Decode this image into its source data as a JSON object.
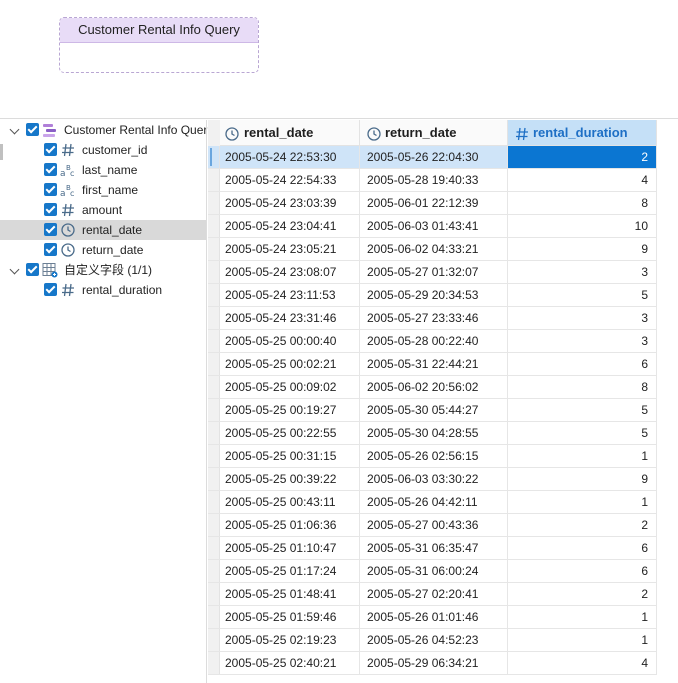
{
  "query_box": {
    "title": "Customer Rental Info Query"
  },
  "tree": {
    "root": {
      "label": "Customer Rental Info Quer",
      "icon": "query-icon",
      "checked": true,
      "expanded": true
    },
    "fields": [
      {
        "label": "customer_id",
        "icon": "hash-icon",
        "checked": true
      },
      {
        "label": "last_name",
        "icon": "abc-icon",
        "checked": true
      },
      {
        "label": "first_name",
        "icon": "abc-icon",
        "checked": true
      },
      {
        "label": "amount",
        "icon": "hash-icon",
        "checked": true
      },
      {
        "label": "rental_date",
        "icon": "clock-icon",
        "checked": true,
        "selected": true
      },
      {
        "label": "return_date",
        "icon": "clock-icon",
        "checked": true
      }
    ],
    "custom_group": {
      "label": "自定义字段 (1/1)",
      "icon": "table-icon",
      "checked": true,
      "expanded": true
    },
    "custom_fields": [
      {
        "label": "rental_duration",
        "icon": "hash-icon",
        "checked": true
      }
    ]
  },
  "grid": {
    "columns": [
      {
        "label": "rental_date",
        "icon": "clock-icon"
      },
      {
        "label": "return_date",
        "icon": "clock-icon"
      },
      {
        "label": "rental_duration",
        "icon": "hash-icon",
        "active": true
      }
    ],
    "rows": [
      [
        "2005-05-24 22:53:30",
        "2005-05-26 22:04:30",
        "2"
      ],
      [
        "2005-05-24 22:54:33",
        "2005-05-28 19:40:33",
        "4"
      ],
      [
        "2005-05-24 23:03:39",
        "2005-06-01 22:12:39",
        "8"
      ],
      [
        "2005-05-24 23:04:41",
        "2005-06-03 01:43:41",
        "10"
      ],
      [
        "2005-05-24 23:05:21",
        "2005-06-02 04:33:21",
        "9"
      ],
      [
        "2005-05-24 23:08:07",
        "2005-05-27 01:32:07",
        "3"
      ],
      [
        "2005-05-24 23:11:53",
        "2005-05-29 20:34:53",
        "5"
      ],
      [
        "2005-05-24 23:31:46",
        "2005-05-27 23:33:46",
        "3"
      ],
      [
        "2005-05-25 00:00:40",
        "2005-05-28 00:22:40",
        "3"
      ],
      [
        "2005-05-25 00:02:21",
        "2005-05-31 22:44:21",
        "6"
      ],
      [
        "2005-05-25 00:09:02",
        "2005-06-02 20:56:02",
        "8"
      ],
      [
        "2005-05-25 00:19:27",
        "2005-05-30 05:44:27",
        "5"
      ],
      [
        "2005-05-25 00:22:55",
        "2005-05-30 04:28:55",
        "5"
      ],
      [
        "2005-05-25 00:31:15",
        "2005-05-26 02:56:15",
        "1"
      ],
      [
        "2005-05-25 00:39:22",
        "2005-06-03 03:30:22",
        "9"
      ],
      [
        "2005-05-25 00:43:11",
        "2005-05-26 04:42:11",
        "1"
      ],
      [
        "2005-05-25 01:06:36",
        "2005-05-27 00:43:36",
        "2"
      ],
      [
        "2005-05-25 01:10:47",
        "2005-05-31 06:35:47",
        "6"
      ],
      [
        "2005-05-25 01:17:24",
        "2005-05-31 06:00:24",
        "6"
      ],
      [
        "2005-05-25 01:48:41",
        "2005-05-27 02:20:41",
        "2"
      ],
      [
        "2005-05-25 01:59:46",
        "2005-05-26 01:01:46",
        "1"
      ],
      [
        "2005-05-25 02:19:23",
        "2005-05-26 04:52:23",
        "1"
      ],
      [
        "2005-05-25 02:40:21",
        "2005-05-29 06:34:21",
        "4"
      ]
    ]
  },
  "colors": {
    "accent": "#0b76d2",
    "checkbox": "#1677c9",
    "selected_row": "#cfe4f8",
    "query_header": "#e8dcf7"
  }
}
